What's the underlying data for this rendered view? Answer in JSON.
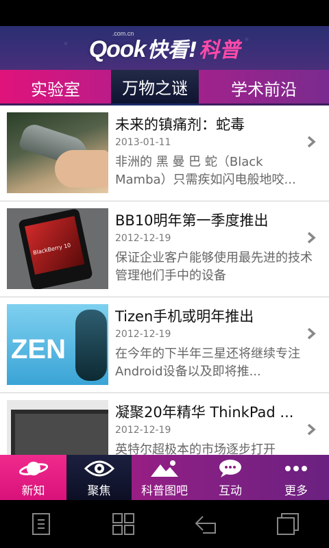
{
  "header": {
    "logo_qook": "Qook",
    "logo_domain": ".com.cn",
    "logo_kankan": "快看!",
    "logo_kepu": "科普"
  },
  "tabs": [
    {
      "label": "实验室",
      "active": false
    },
    {
      "label": "万物之谜",
      "active": true
    },
    {
      "label": "学术前沿",
      "active": false
    }
  ],
  "articles": [
    {
      "title": "未来的镇痛剂：蛇毒",
      "date": "2013-01-11",
      "desc": "非洲的 黑 曼 巴 蛇（Black Mamba）只需疾如闪电般地咬..."
    },
    {
      "title": "BB10明年第一季度推出",
      "date": "2012-12-19",
      "desc": "保证企业客户能够使用最先进的技术管理他们手中的设备"
    },
    {
      "title": "Tizen手机或明年推出",
      "date": "2012-12-19",
      "desc": "在今年的下半年三星还将继续专注Android设备以及即将推..."
    },
    {
      "title": "凝聚20年精华 ThinkPad ...",
      "date": "2012-12-19",
      "desc": "英特尔超极本的市场逐步打开"
    }
  ],
  "thumbs": {
    "bb_brand": "BlackBerry 10",
    "zen_text": "ZEN"
  },
  "bottom_nav": [
    {
      "label": "新知",
      "icon": "planet-icon",
      "active": false
    },
    {
      "label": "聚焦",
      "icon": "eye-icon",
      "active": true
    },
    {
      "label": "科普图吧",
      "icon": "mountain-image-icon",
      "active": false
    },
    {
      "label": "互动",
      "icon": "chat-bubble-icon",
      "active": false
    },
    {
      "label": "更多",
      "icon": "more-dots-icon",
      "active": false
    }
  ],
  "system_bar": [
    {
      "icon": "menu-icon"
    },
    {
      "icon": "home-grid-icon"
    },
    {
      "icon": "back-icon"
    },
    {
      "icon": "recent-apps-icon"
    }
  ],
  "colors": {
    "accent_pink": "#e0137b",
    "accent_purple": "#7a2b8f",
    "header_navy": "#2b2f72",
    "active_dark": "#0e1430"
  }
}
